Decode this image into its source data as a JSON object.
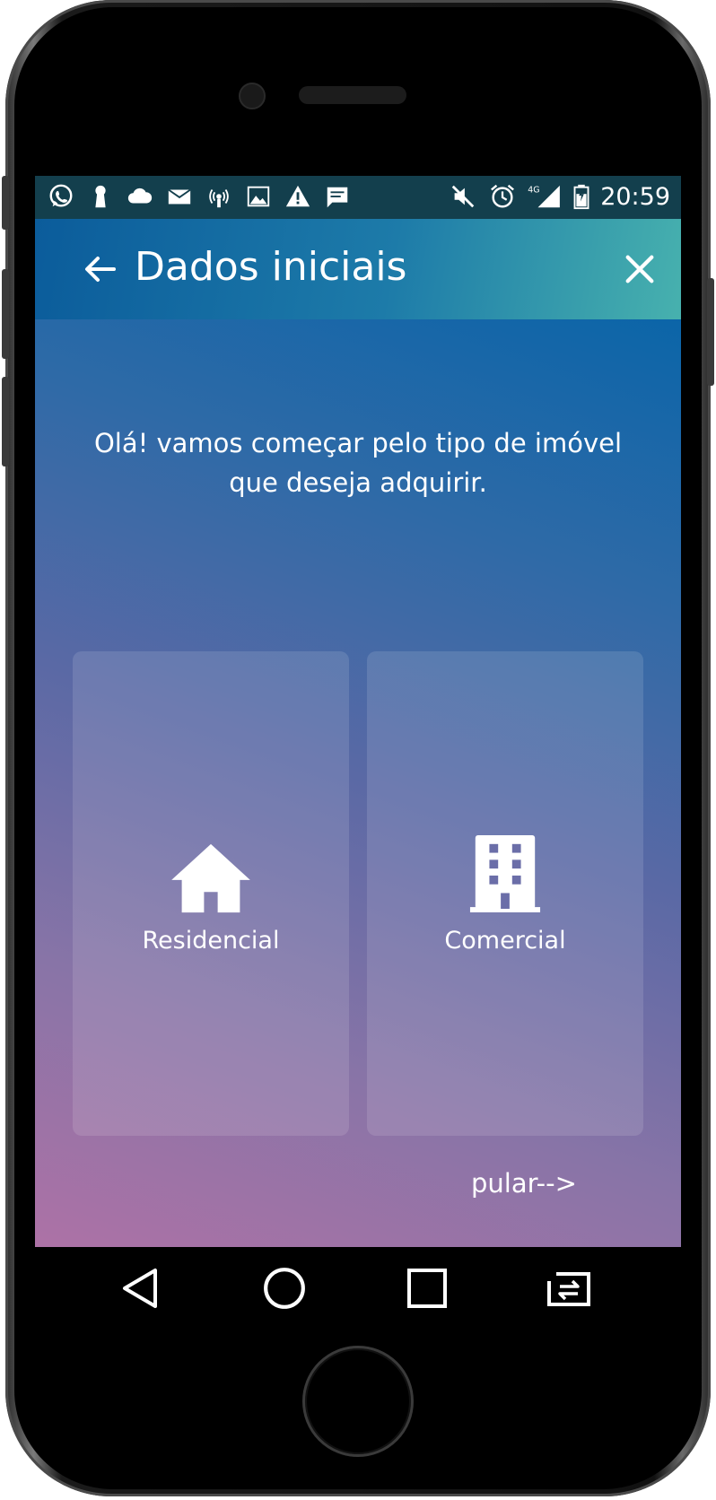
{
  "status_bar": {
    "left_icons": [
      "whatsapp-icon",
      "keyhole-icon",
      "cloud-icon",
      "mail-icon",
      "hotspot-icon",
      "image-icon",
      "warning-icon",
      "message-icon"
    ],
    "right_icons": [
      "mute-icon",
      "alarm-icon",
      "signal-4g-icon",
      "battery-icon"
    ],
    "network_label": "4G",
    "time": "20:59"
  },
  "app_bar": {
    "title": "Dados iniciais",
    "back_icon": "arrow-left-icon",
    "close_icon": "close-icon"
  },
  "content": {
    "intro_line1": "Olá! vamos começar pelo tipo de imóvel",
    "intro_line2": "que deseja adquirir.",
    "options": [
      {
        "label": "Residencial",
        "icon": "house-icon"
      },
      {
        "label": "Comercial",
        "icon": "building-icon"
      }
    ],
    "skip_label": "pular-->"
  },
  "nav_bar": {
    "buttons": [
      "back-triangle-icon",
      "home-circle-icon",
      "recents-square-icon",
      "switch-apps-icon"
    ]
  },
  "colors": {
    "status_bar_bg": "#133f4d",
    "app_bar_start": "#0b5c9b",
    "app_bar_end": "#47b1ae",
    "content_top": "#0b65a8",
    "content_bottom": "#ad72a6"
  }
}
